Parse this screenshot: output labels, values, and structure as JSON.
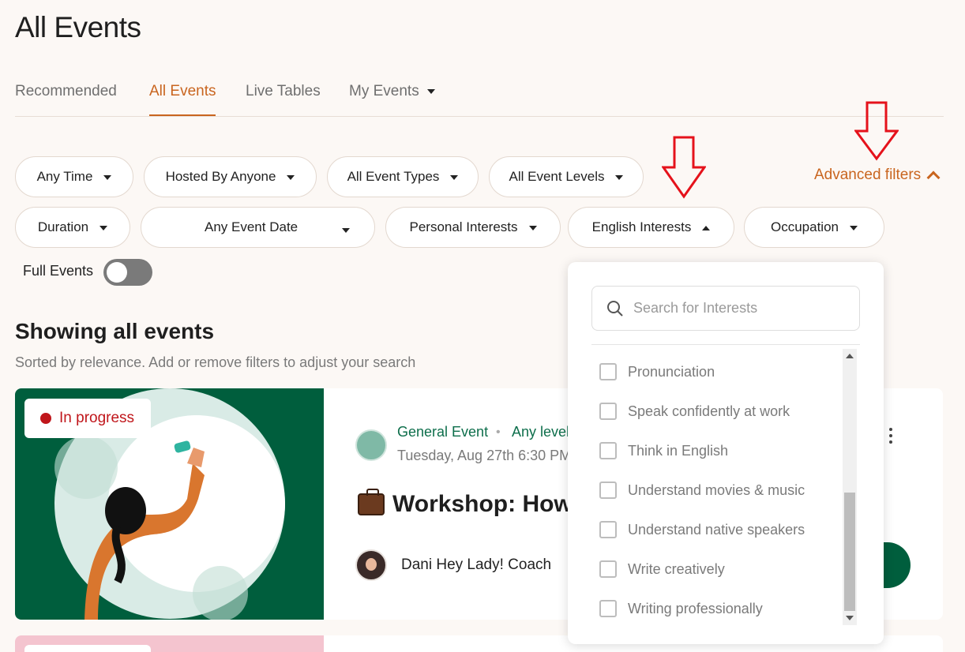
{
  "page_title": "All Events",
  "tabs": [
    {
      "label": "Recommended"
    },
    {
      "label": "All Events"
    },
    {
      "label": "Live Tables"
    },
    {
      "label": "My Events"
    }
  ],
  "filters_row1": [
    {
      "label": "Any Time"
    },
    {
      "label": "Hosted By Anyone"
    },
    {
      "label": "All Event Types"
    },
    {
      "label": "All Event Levels"
    }
  ],
  "advanced_filters_label": "Advanced filters",
  "filters_row2": [
    {
      "label": "Duration"
    },
    {
      "label": "Any Event Date"
    },
    {
      "label": "Personal Interests"
    },
    {
      "label": "English Interests"
    },
    {
      "label": "Occupation"
    }
  ],
  "full_events_label": "Full Events",
  "showing_title": "Showing all events",
  "sorted_text": "Sorted by relevance. Add or remove filters to adjust your search",
  "event": {
    "status": "In progress",
    "type": "General Event",
    "separator": "•",
    "level": "Any level",
    "date": "Tuesday, Aug 27th 6:30 PM",
    "title": "Workshop: How",
    "host": "Dani Hey Lady! Coach"
  },
  "interests_dropdown": {
    "search_placeholder": "Search for Interests",
    "options": [
      {
        "label": "Pronunciation"
      },
      {
        "label": "Speak confidently at work"
      },
      {
        "label": "Think in English"
      },
      {
        "label": "Understand movies & music"
      },
      {
        "label": "Understand native speakers"
      },
      {
        "label": "Write creatively"
      },
      {
        "label": "Writing professionally"
      }
    ]
  },
  "colors": {
    "accent": "#c9651f",
    "brand_green": "#005e3d",
    "status_red": "#c0161b",
    "annotation_arrow": "#e5121b"
  }
}
